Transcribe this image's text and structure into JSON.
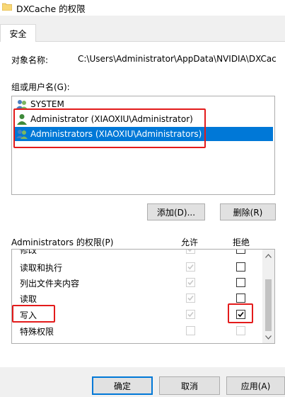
{
  "window": {
    "title": "DXCache 的权限"
  },
  "tabs": [
    {
      "label": "安全"
    }
  ],
  "object": {
    "label": "对象名称:",
    "path": "C:\\Users\\Administrator\\AppData\\NVIDIA\\DXCache"
  },
  "groups": {
    "label": "组或用户名(G):",
    "items": [
      {
        "name": "SYSTEM",
        "selected": false
      },
      {
        "name": "Administrator (XIAOXIU\\Administrator)",
        "selected": false
      },
      {
        "name": "Administrators (XIAOXIU\\Administrators)",
        "selected": true
      }
    ]
  },
  "buttons": {
    "add": "添加(D)...",
    "remove": "删除(R)"
  },
  "permissions": {
    "label": "Administrators 的权限(P)",
    "allow_header": "允许",
    "deny_header": "拒绝",
    "rows": [
      {
        "name": "修改",
        "allow": true,
        "deny": false
      },
      {
        "name": "读取和执行",
        "allow": true,
        "deny": false
      },
      {
        "name": "列出文件夹内容",
        "allow": true,
        "deny": false
      },
      {
        "name": "读取",
        "allow": true,
        "deny": false
      },
      {
        "name": "写入",
        "allow": true,
        "deny": true
      },
      {
        "name": "特殊权限",
        "allow": false,
        "deny": false
      }
    ]
  },
  "footer": {
    "ok": "确定",
    "cancel": "取消",
    "apply": "应用(A)"
  },
  "colors": {
    "selection": "#0078d7",
    "highlight": "#e31b1b"
  }
}
